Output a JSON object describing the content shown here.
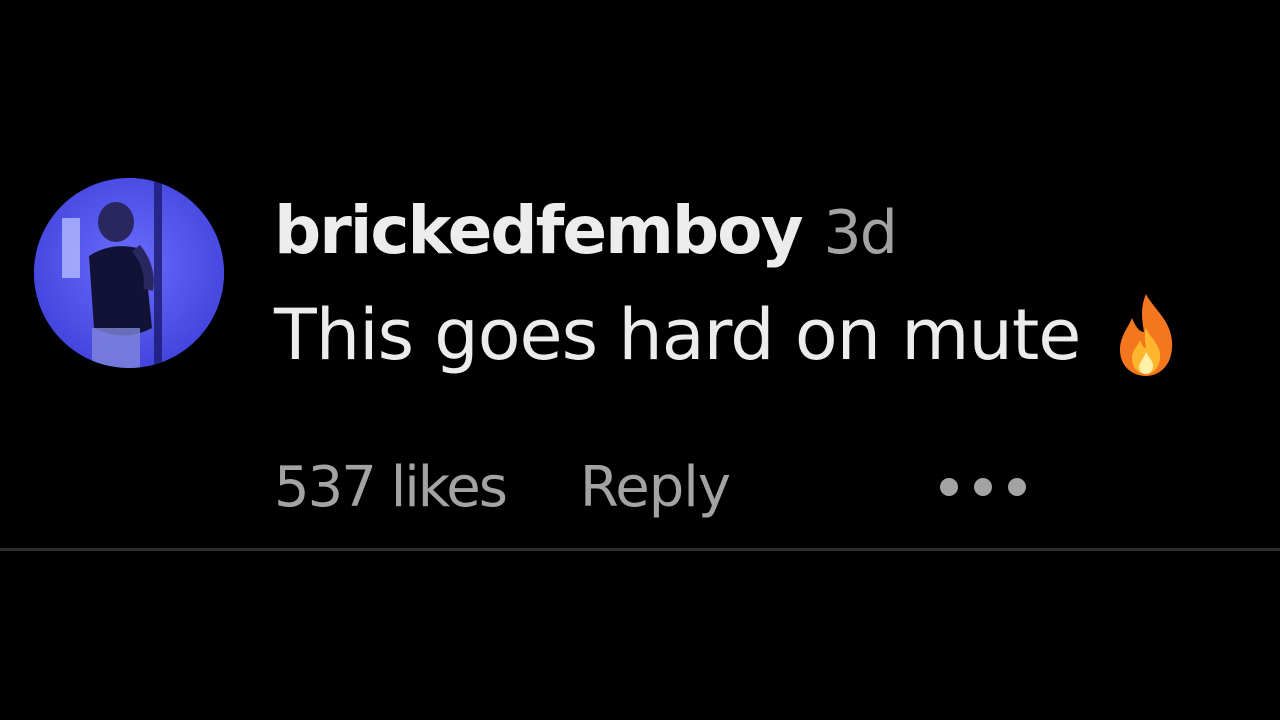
{
  "comment": {
    "username": "brickedfemboy",
    "timestamp": "3d",
    "text": "This goes hard on mute",
    "emoji_icon": "fire-icon",
    "likes_label": "537 likes",
    "reply_label": "Reply",
    "more_icon": "more-options-icon"
  },
  "colors": {
    "background": "#000000",
    "primary_text": "#ececec",
    "secondary_text": "#a3a3a3",
    "divider": "#2e2e2e",
    "avatar_tint": "#4f52e8"
  }
}
